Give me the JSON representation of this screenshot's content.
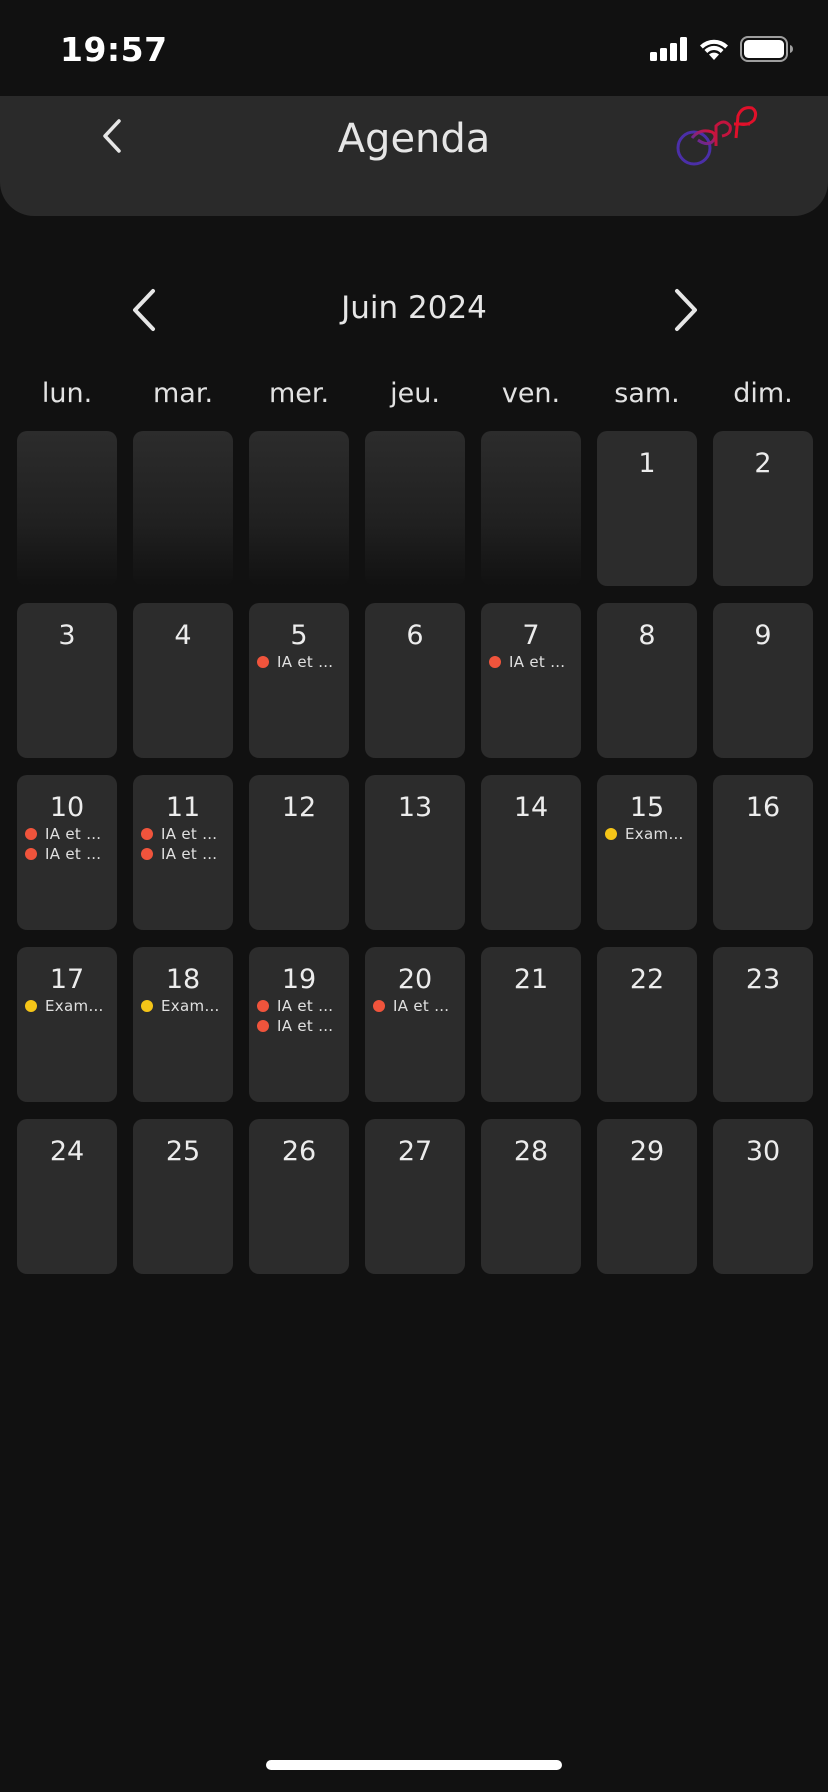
{
  "status_bar": {
    "time": "19:57"
  },
  "header": {
    "title": "Agenda",
    "back_icon": "chevron-left-icon",
    "logo_icon": "epf-logo"
  },
  "calendar": {
    "month_label": "Juin 2024",
    "weekdays": [
      "lun.",
      "mar.",
      "mer.",
      "jeu.",
      "ven.",
      "sam.",
      "dim."
    ],
    "event_colors": {
      "course": "#f0543c",
      "exam": "#f5c518"
    },
    "days": [
      {
        "day": "",
        "empty": true,
        "events": []
      },
      {
        "day": "",
        "empty": true,
        "events": []
      },
      {
        "day": "",
        "empty": true,
        "events": []
      },
      {
        "day": "",
        "empty": true,
        "events": []
      },
      {
        "day": "",
        "empty": true,
        "events": []
      },
      {
        "day": "1",
        "events": []
      },
      {
        "day": "2",
        "events": []
      },
      {
        "day": "3",
        "events": []
      },
      {
        "day": "4",
        "events": []
      },
      {
        "day": "5",
        "events": [
          {
            "label": "IA et A…",
            "color": "#f0543c"
          }
        ]
      },
      {
        "day": "6",
        "events": []
      },
      {
        "day": "7",
        "events": [
          {
            "label": "IA et A…",
            "color": "#f0543c"
          }
        ]
      },
      {
        "day": "8",
        "events": []
      },
      {
        "day": "9",
        "events": []
      },
      {
        "day": "10",
        "events": [
          {
            "label": "IA et A…",
            "color": "#f0543c"
          },
          {
            "label": "IA et A…",
            "color": "#f0543c"
          }
        ]
      },
      {
        "day": "11",
        "events": [
          {
            "label": "IA et A…",
            "color": "#f0543c"
          },
          {
            "label": "IA et A…",
            "color": "#f0543c"
          }
        ]
      },
      {
        "day": "12",
        "events": []
      },
      {
        "day": "13",
        "events": []
      },
      {
        "day": "14",
        "events": []
      },
      {
        "day": "15",
        "events": [
          {
            "label": "Exame…",
            "color": "#f5c518"
          }
        ]
      },
      {
        "day": "16",
        "events": []
      },
      {
        "day": "17",
        "events": [
          {
            "label": "Exame…",
            "color": "#f5c518"
          }
        ]
      },
      {
        "day": "18",
        "events": [
          {
            "label": "Exame…",
            "color": "#f5c518"
          }
        ]
      },
      {
        "day": "19",
        "events": [
          {
            "label": "IA et A…",
            "color": "#f0543c"
          },
          {
            "label": "IA et A…",
            "color": "#f0543c"
          }
        ]
      },
      {
        "day": "20",
        "events": [
          {
            "label": "IA et A…",
            "color": "#f0543c"
          }
        ]
      },
      {
        "day": "21",
        "events": []
      },
      {
        "day": "22",
        "events": []
      },
      {
        "day": "23",
        "events": []
      },
      {
        "day": "24",
        "events": []
      },
      {
        "day": "25",
        "events": []
      },
      {
        "day": "26",
        "events": []
      },
      {
        "day": "27",
        "events": []
      },
      {
        "day": "28",
        "events": []
      },
      {
        "day": "29",
        "events": []
      },
      {
        "day": "30",
        "events": []
      }
    ]
  }
}
